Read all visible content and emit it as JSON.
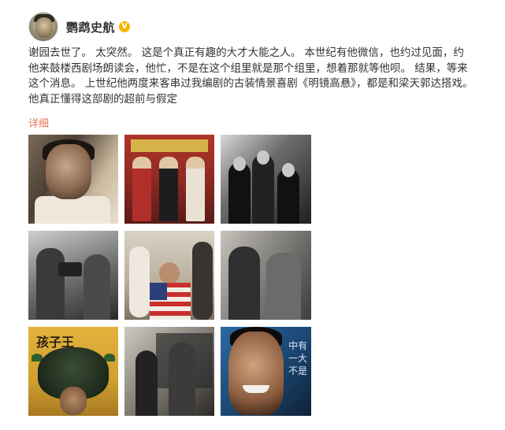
{
  "post": {
    "author": {
      "name": "鹦鹉史航",
      "verified_badge": "V"
    },
    "text": "谢园去世了。 太突然。 这是个真正有趣的大才大能之人。 本世纪有他微信，也约过见面，约他来鼓楼西剧场朗读会，他忙，不是在这个组里就是那个组里，想着那就等他呗。 结果，等来这个消息。 上世纪他两度来客串过我编剧的古装情景喜剧《明镜高悬》，都是和梁天郭达搭戏。他真正懂得这部剧的超前与假定",
    "more_label": "详细",
    "images": [
      {
        "name": "photo-1"
      },
      {
        "name": "photo-2"
      },
      {
        "name": "photo-3"
      },
      {
        "name": "photo-4"
      },
      {
        "name": "photo-5"
      },
      {
        "name": "photo-6"
      },
      {
        "name": "photo-7",
        "poster_title": "孩子王"
      },
      {
        "name": "photo-8"
      },
      {
        "name": "photo-9",
        "glyph_text": "中有\n一大\n不是"
      }
    ]
  },
  "colors": {
    "link": "#eb7350",
    "verified": "#f7b500"
  }
}
